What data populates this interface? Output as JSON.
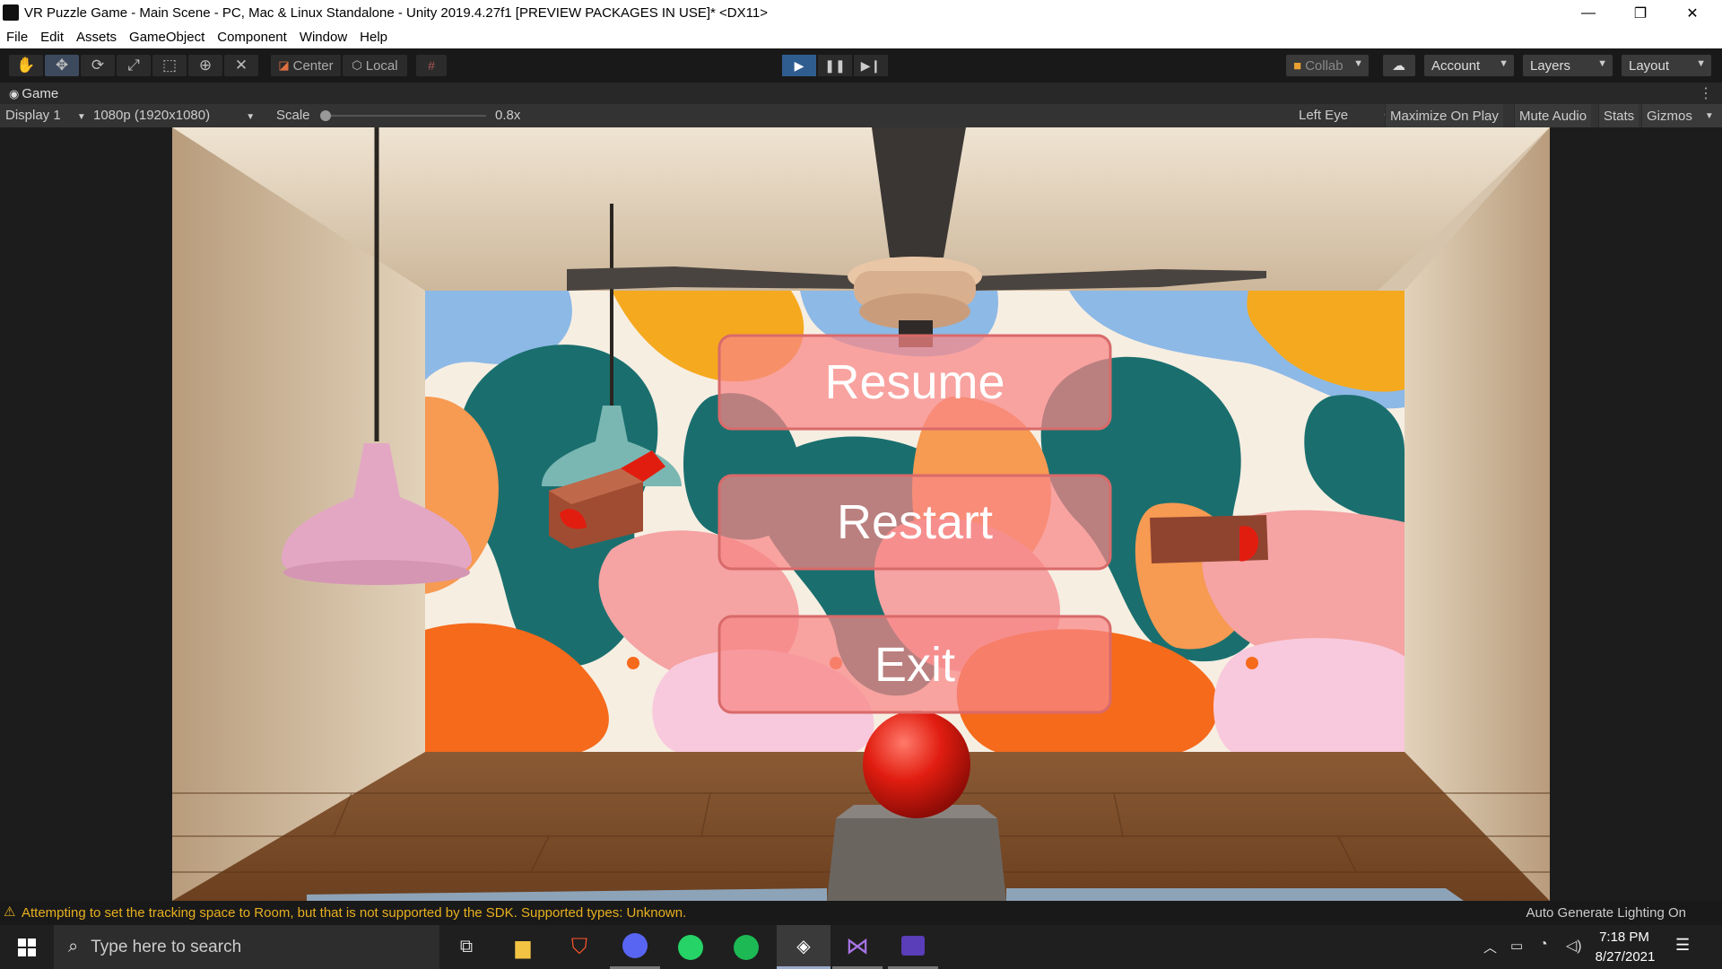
{
  "window": {
    "title": "VR Puzzle Game - Main Scene - PC, Mac & Linux Standalone - Unity 2019.4.27f1 [PREVIEW PACKAGES IN USE]* <DX11>",
    "minimize": "—",
    "maximize": "❐",
    "close": "✕"
  },
  "menu": [
    "File",
    "Edit",
    "Assets",
    "GameObject",
    "Component",
    "Window",
    "Help"
  ],
  "toolbar": {
    "pivot_label": "Center",
    "space_label": "Local",
    "collab_label": "Collab",
    "account_label": "Account",
    "layers_label": "Layers",
    "layout_label": "Layout"
  },
  "game_tab": {
    "label": "Game"
  },
  "game_bar": {
    "display": "Display 1",
    "resolution": "1080p (1920x1080)",
    "scale_label": "Scale",
    "scale_value": "0.8x",
    "eye": "Left Eye",
    "maximize_on_play": "Maximize On Play",
    "mute_audio": "Mute Audio",
    "stats": "Stats",
    "gizmos": "Gizmos"
  },
  "pause_menu": {
    "resume": "Resume",
    "restart": "Restart",
    "exit": "Exit"
  },
  "status": {
    "warning": "Attempting to set the tracking space to Room, but that is not supported by the SDK. Supported types: Unknown.",
    "lighting": "Auto Generate Lighting On"
  },
  "taskbar": {
    "search_placeholder": "Type here to search",
    "time": "7:18 PM",
    "date": "8/27/2021"
  }
}
